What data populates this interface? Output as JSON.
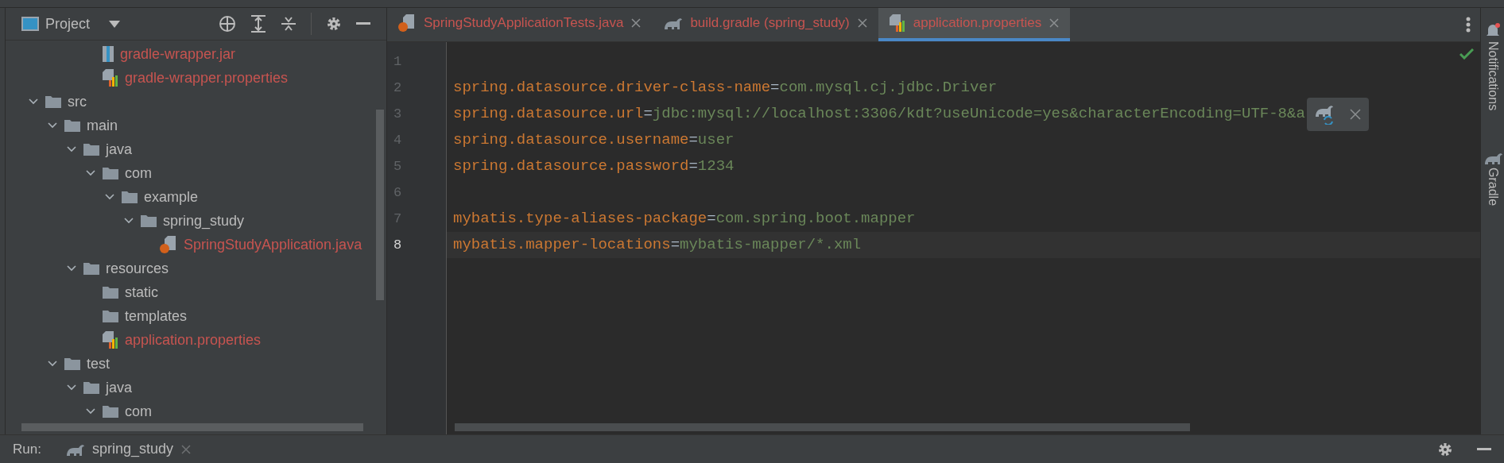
{
  "project_panel": {
    "title": "Project",
    "wrapper_files": [
      {
        "label": "gradle-wrapper.jar",
        "kind": "jar",
        "untracked": true
      },
      {
        "label": "gradle-wrapper.properties",
        "kind": "properties",
        "untracked": true
      }
    ],
    "tree": [
      {
        "label": "src",
        "kind": "folder",
        "expanded": true,
        "children": [
          {
            "label": "main",
            "kind": "folder",
            "expanded": true,
            "children": [
              {
                "label": "java",
                "kind": "folder",
                "expanded": true,
                "children": [
                  {
                    "label": "com",
                    "kind": "folder",
                    "expanded": true,
                    "children": [
                      {
                        "label": "example",
                        "kind": "folder",
                        "expanded": true,
                        "children": [
                          {
                            "label": "spring_study",
                            "kind": "folder",
                            "expanded": true,
                            "children": [
                              {
                                "label": "SpringStudyApplication.java",
                                "kind": "java",
                                "untracked": true
                              }
                            ]
                          }
                        ]
                      }
                    ]
                  }
                ]
              },
              {
                "label": "resources",
                "kind": "folder",
                "expanded": true,
                "children": [
                  {
                    "label": "static",
                    "kind": "folder",
                    "expanded": false
                  },
                  {
                    "label": "templates",
                    "kind": "folder",
                    "expanded": false
                  },
                  {
                    "label": "application.properties",
                    "kind": "properties",
                    "untracked": true
                  }
                ]
              }
            ]
          },
          {
            "label": "test",
            "kind": "folder",
            "expanded": true,
            "children": [
              {
                "label": "java",
                "kind": "folder",
                "expanded": true,
                "children": [
                  {
                    "label": "com",
                    "kind": "folder",
                    "expanded": true
                  }
                ]
              }
            ]
          }
        ]
      }
    ]
  },
  "tabs": [
    {
      "label": "SpringStudyApplicationTests.java",
      "kind": "java",
      "selected": false
    },
    {
      "label": "build.gradle (spring_study)",
      "kind": "gradle",
      "selected": false
    },
    {
      "label": "application.properties",
      "kind": "properties",
      "selected": true
    }
  ],
  "editor": {
    "lines": [
      {
        "number": "1",
        "current": false
      },
      {
        "number": "2",
        "current": false,
        "key": "spring.datasource.driver-class-name",
        "sep": "=",
        "value": "com.mysql.cj.jdbc.Driver"
      },
      {
        "number": "3",
        "current": false,
        "key": "spring.datasource.url",
        "sep": "=",
        "value": "jdbc:mysql://localhost:3306/kdt?useUnicode=yes&characterEncoding=UTF-8&a"
      },
      {
        "number": "4",
        "current": false,
        "key": "spring.datasource.username",
        "sep": "=",
        "value": "user"
      },
      {
        "number": "5",
        "current": false,
        "key": "spring.datasource.password",
        "sep": "=",
        "value": "1234"
      },
      {
        "number": "6",
        "current": false
      },
      {
        "number": "7",
        "current": false,
        "key": "mybatis.type-aliases-package",
        "sep": "=",
        "value": "com.spring.boot.mapper"
      },
      {
        "number": "8",
        "current": true,
        "key": "mybatis.mapper-locations",
        "sep": "=",
        "value": "mybatis-mapper/*.xml"
      }
    ]
  },
  "right_strip": [
    "Notifications",
    "Gradle"
  ],
  "run_bar": {
    "label": "Run:",
    "tab": "spring_study"
  }
}
